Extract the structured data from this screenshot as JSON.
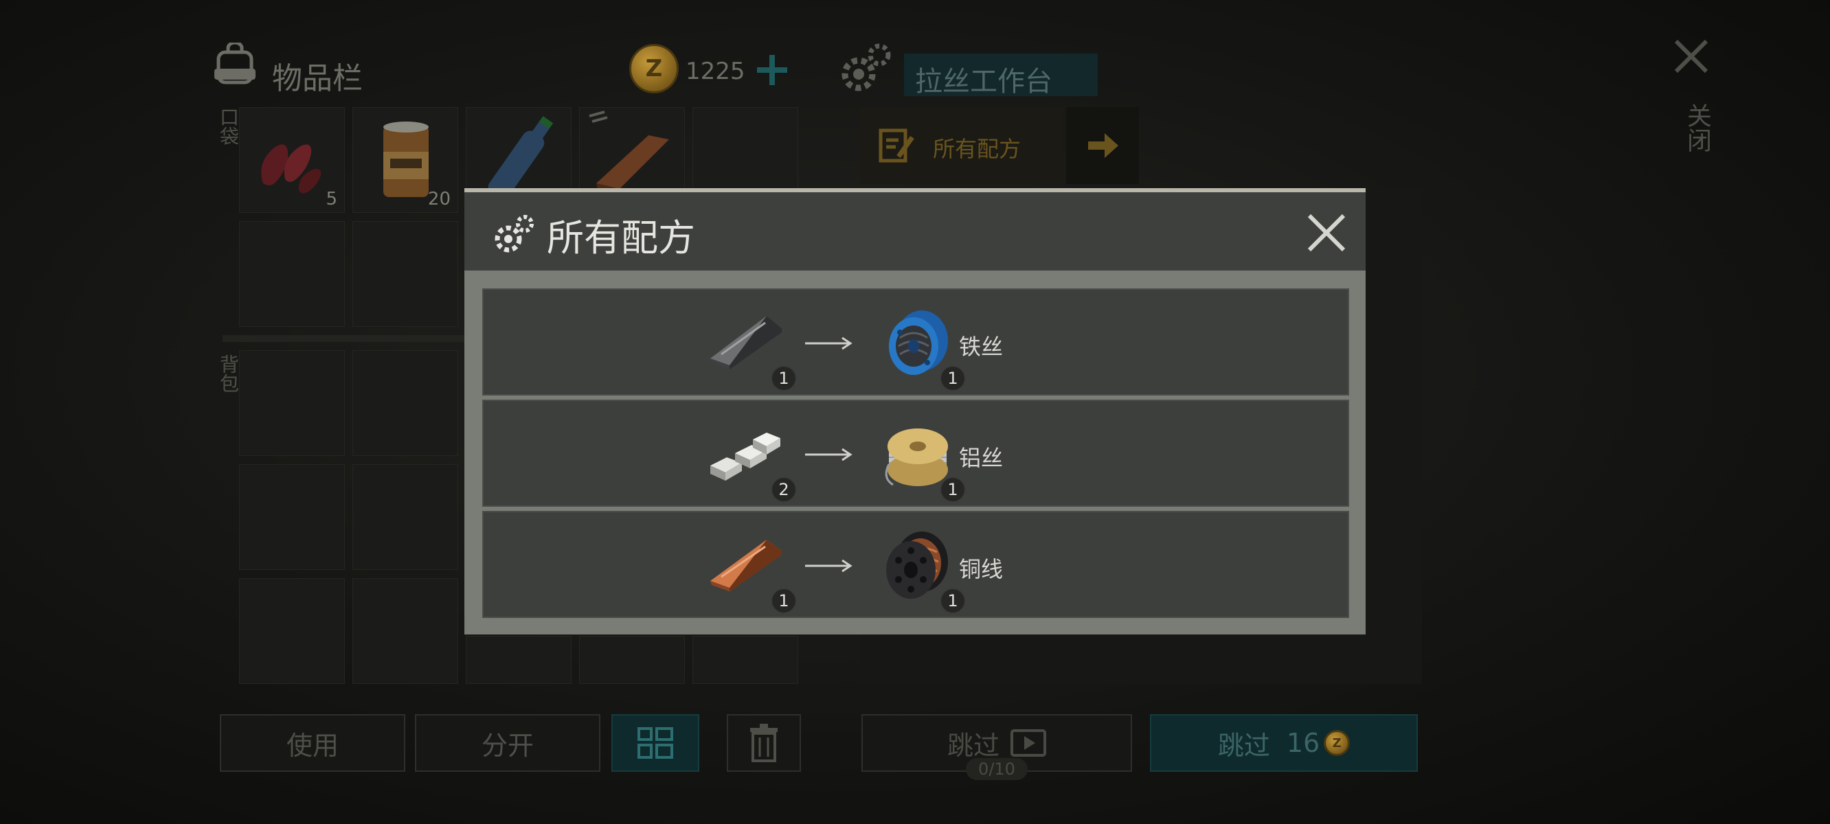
{
  "inventory": {
    "title": "物品栏",
    "currency": "1225",
    "pocket_label": "口袋",
    "backpack_label": "背包",
    "pocket_items": [
      {
        "icon": "raw-meat-icon",
        "count": "5"
      },
      {
        "icon": "canned-food-icon",
        "count": "20"
      },
      {
        "icon": "water-bottle-icon",
        "count": ""
      },
      {
        "icon": "copper-ingot-icon",
        "count": ""
      }
    ]
  },
  "workbench": {
    "title": "拉丝工作台",
    "recipes_tab": "所有配方"
  },
  "close_panel": {
    "label": "关闭"
  },
  "buttons": {
    "use": "使用",
    "split": "分开",
    "skip": "跳过",
    "skip_ad_counter": "0/10",
    "skip_paid_label": "跳过",
    "skip_paid_cost": "16"
  },
  "modal": {
    "title": "所有配方",
    "recipes": [
      {
        "input_icon": "iron-ingot-icon",
        "input_qty": "1",
        "output_icon": "iron-wire-spool-icon",
        "output_qty": "1",
        "name": "铁丝"
      },
      {
        "input_icon": "aluminum-ingots-icon",
        "input_qty": "2",
        "output_icon": "aluminum-wire-spool-icon",
        "output_qty": "1",
        "name": "铝丝"
      },
      {
        "input_icon": "copper-ingot-icon",
        "input_qty": "1",
        "output_icon": "copper-wire-spool-icon",
        "output_qty": "1",
        "name": "铜线"
      }
    ]
  },
  "colors": {
    "accent_gold": "#c89a2c",
    "accent_teal": "#1f6b6d",
    "modal_header": "#3e403e",
    "modal_frame": "#7a7c76"
  }
}
